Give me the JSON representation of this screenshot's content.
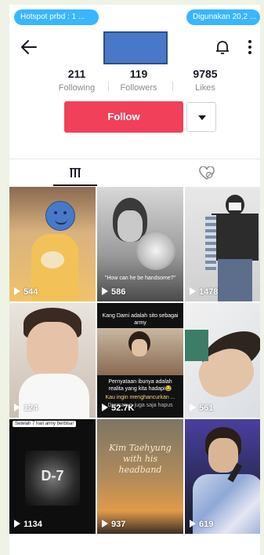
{
  "status": {
    "hotspot_text": "Hotspot prbd : 1 ...",
    "usage_text": "Digunakan 20,2 ..."
  },
  "icons": {
    "back": "arrow-left-icon",
    "bell": "bell-icon",
    "more": "more-vertical-icon",
    "dropdown": "caret-down-icon",
    "grid": "grid-icon",
    "liked": "heart-hidden-icon",
    "play": "play-icon"
  },
  "profile": {
    "stats": [
      {
        "value": "211",
        "label": "Following"
      },
      {
        "value": "119",
        "label": "Followers"
      },
      {
        "value": "9785",
        "label": "Likes"
      }
    ],
    "follow_label": "Follow"
  },
  "colors": {
    "follow": "#f0405a",
    "pill": "#38b6ff",
    "redaction": "#4a78c8"
  },
  "videos": [
    {
      "views": "544"
    },
    {
      "views": "586",
      "caption": "\"How can he be handsome?\""
    },
    {
      "views": "1478"
    },
    {
      "views": "124"
    },
    {
      "views": "52.7K",
      "caption_top": "Kang Dami adalah sito sebagai army",
      "caption_mid": "Pernyataan ibunya adalah realita yang kita hadapi😂",
      "caption_mid2": "Kau ingin menghancurkan ...",
      "caption_small": "Dramanya juga saja hapus"
    },
    {
      "views": "561"
    },
    {
      "views": "1134",
      "tag": "Setelah 7 hari army berbisa!",
      "caption": "D-7"
    },
    {
      "views": "937",
      "caption": "Kim Taehyung with his headband"
    },
    {
      "views": "619"
    }
  ]
}
